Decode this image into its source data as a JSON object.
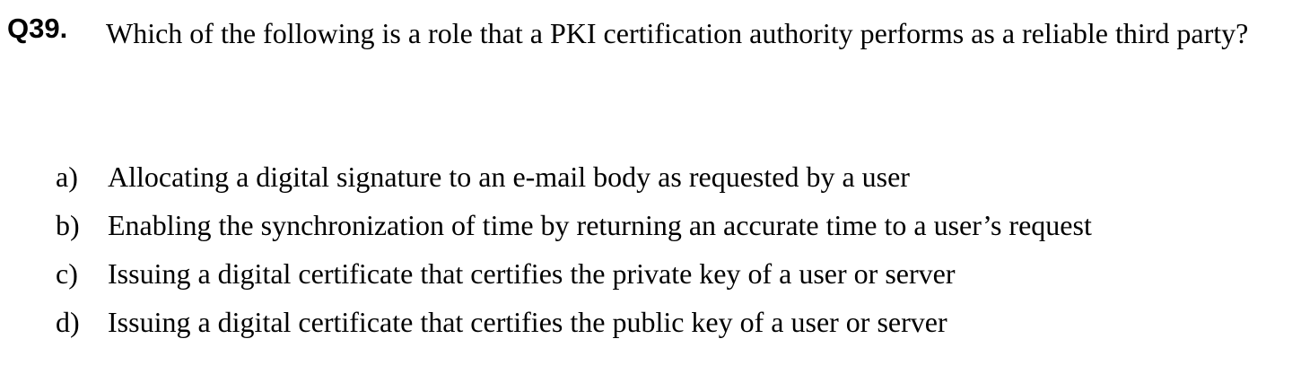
{
  "question": {
    "number": "Q39.",
    "text": "Which of the following is a role that a PKI certification authority performs as a reliable third party?"
  },
  "options": [
    {
      "letter": "a)",
      "text": "Allocating a digital signature to an e-mail body as requested by a user"
    },
    {
      "letter": "b)",
      "text": "Enabling the synchronization of time by returning an accurate time to a user’s request"
    },
    {
      "letter": "c)",
      "text": "Issuing a digital certificate that certifies the private key of a user or server"
    },
    {
      "letter": "d)",
      "text": "Issuing a digital certificate that certifies the public key of a user or server"
    }
  ]
}
